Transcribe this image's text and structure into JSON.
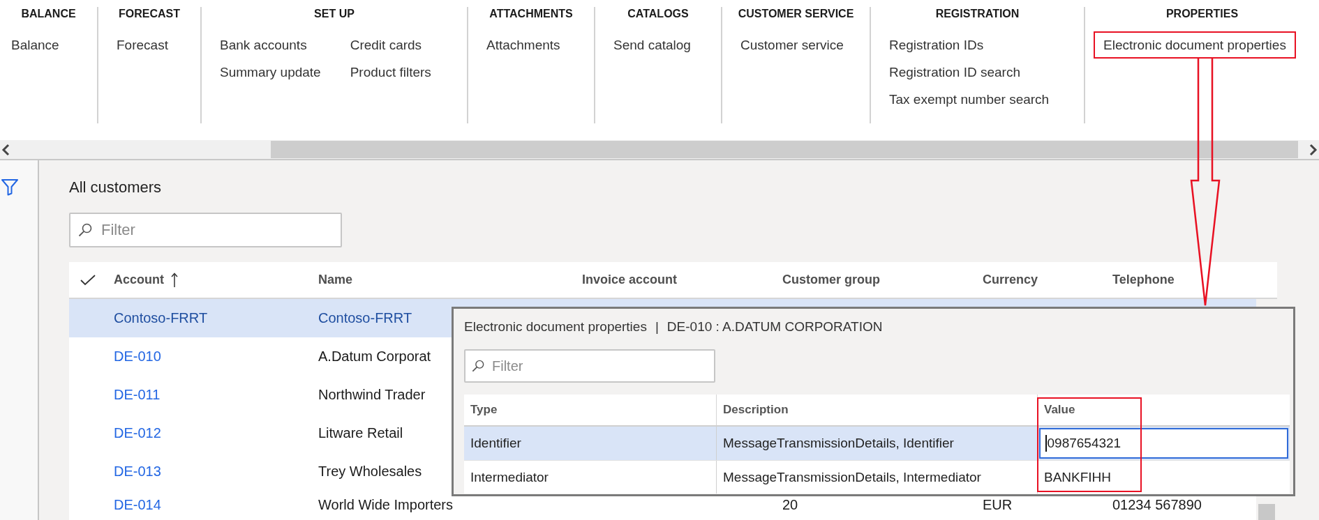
{
  "ribbon": {
    "groups": [
      {
        "title": "BALANCE",
        "columns": [
          [
            {
              "label": "Balance",
              "highlighted": false
            }
          ]
        ]
      },
      {
        "title": "FORECAST",
        "columns": [
          [
            {
              "label": "Forecast",
              "highlighted": false
            }
          ]
        ]
      },
      {
        "title": "SET UP",
        "columns": [
          [
            {
              "label": "Bank accounts",
              "highlighted": false
            },
            {
              "label": "Summary update",
              "highlighted": false
            }
          ],
          [
            {
              "label": "Credit cards",
              "highlighted": false
            },
            {
              "label": "Product filters",
              "highlighted": false
            }
          ]
        ]
      },
      {
        "title": "ATTACHMENTS",
        "columns": [
          [
            {
              "label": "Attachments",
              "highlighted": false
            }
          ]
        ]
      },
      {
        "title": "CATALOGS",
        "columns": [
          [
            {
              "label": "Send catalog",
              "highlighted": false
            }
          ]
        ]
      },
      {
        "title": "CUSTOMER SERVICE",
        "columns": [
          [
            {
              "label": "Customer service",
              "highlighted": false
            }
          ]
        ]
      },
      {
        "title": "REGISTRATION",
        "columns": [
          [
            {
              "label": "Registration IDs",
              "highlighted": false
            },
            {
              "label": "Registration ID search",
              "highlighted": false
            },
            {
              "label": "Tax exempt number search",
              "highlighted": false
            }
          ]
        ]
      },
      {
        "title": "PROPERTIES",
        "columns": [
          [
            {
              "label": "Electronic document properties",
              "highlighted": true
            }
          ]
        ]
      }
    ]
  },
  "customers": {
    "title": "All customers",
    "filter": {
      "placeholder": "Filter"
    },
    "columns": [
      {
        "label": "Account",
        "sorted": true
      },
      {
        "label": "Name",
        "sorted": false
      },
      {
        "label": "Invoice account",
        "sorted": false
      },
      {
        "label": "Customer group",
        "sorted": false
      },
      {
        "label": "Currency",
        "sorted": false
      },
      {
        "label": "Telephone",
        "sorted": false
      }
    ],
    "rows": [
      {
        "selected": true,
        "account": "Contoso-FRRT",
        "name": "Contoso-FRRT"
      },
      {
        "selected": false,
        "account": "DE-010",
        "name": "A.Datum Corporat"
      },
      {
        "selected": false,
        "account": "DE-011",
        "name": "Northwind Trader"
      },
      {
        "selected": false,
        "account": "DE-012",
        "name": "Litware Retail"
      },
      {
        "selected": false,
        "account": "DE-013",
        "name": "Trey Wholesales"
      },
      {
        "selected": false,
        "account": "DE-014",
        "name": "World Wide Importers",
        "customer_group": "20",
        "currency": "EUR",
        "telephone": "01234 567890"
      }
    ]
  },
  "dialog": {
    "title": "Electronic document properties",
    "separator": "|",
    "subtitle": "DE-010 : A.DATUM CORPORATION",
    "filter": {
      "placeholder": "Filter"
    },
    "columns": [
      {
        "label": "Type",
        "highlighted": false
      },
      {
        "label": "Description",
        "highlighted": false
      },
      {
        "label": "Value",
        "highlighted": true
      }
    ],
    "rows": [
      {
        "type": "Identifier",
        "description": "MessageTransmissionDetails, Identifier",
        "value": "0987654321",
        "selected": true,
        "editing": true
      },
      {
        "type": "Intermediator",
        "description": "MessageTransmissionDetails, Intermediator",
        "value": "BANKFIHH",
        "selected": false,
        "editing": false
      }
    ]
  }
}
